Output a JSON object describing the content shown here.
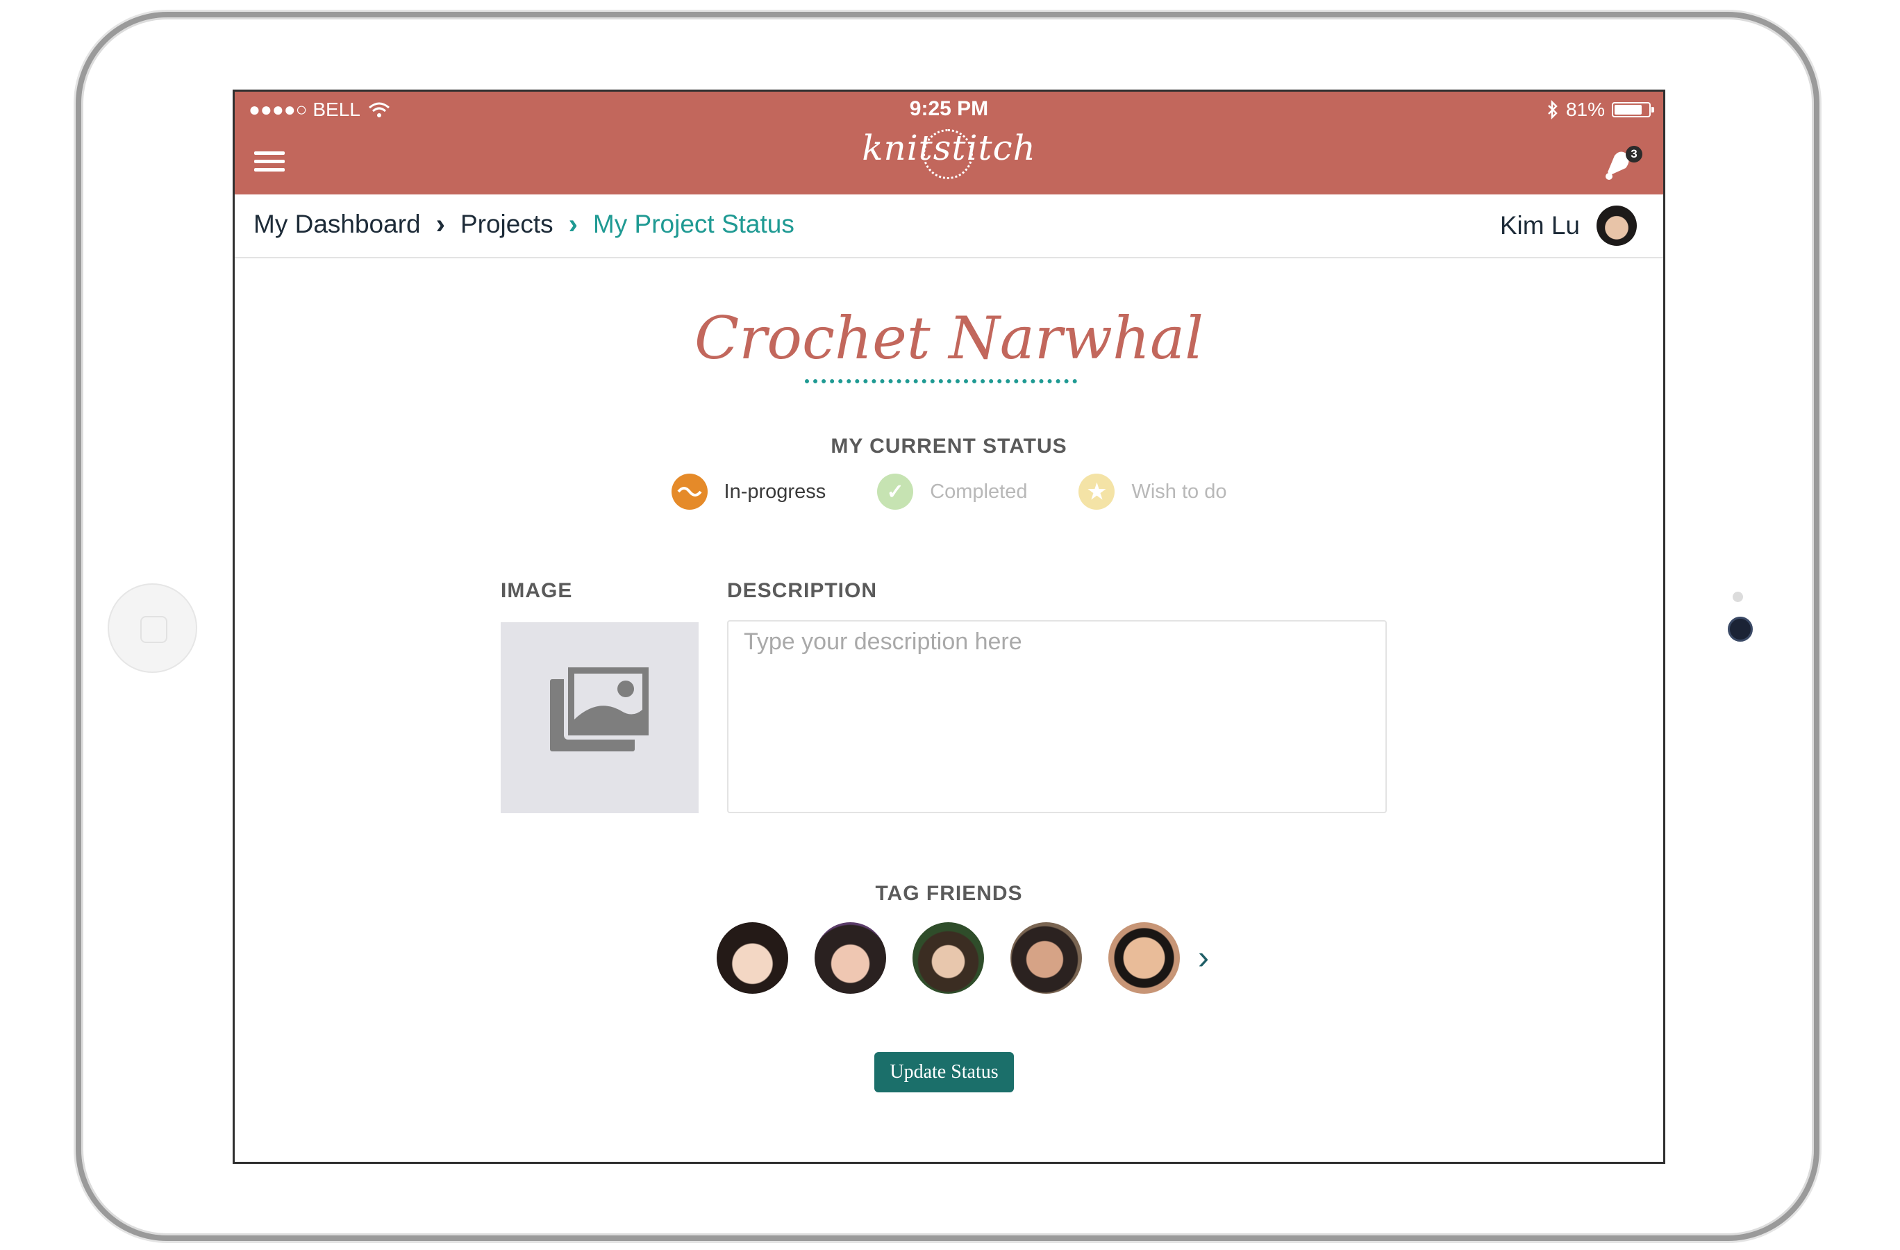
{
  "status_bar": {
    "carrier": "●●●●○ BELL",
    "time": "9:25 PM",
    "battery": "81%",
    "battery_level": 0.81
  },
  "app": {
    "logo": "knitstitch",
    "notifications_count": "3"
  },
  "breadcrumb": [
    "My Dashboard",
    "Projects",
    "My Project Status"
  ],
  "user": {
    "name": "Kim Lu"
  },
  "project": {
    "title": "Crochet Narwhal"
  },
  "status_section": {
    "heading": "MY CURRENT STATUS",
    "options": [
      {
        "label": "In-progress",
        "state": "selected",
        "color": "#e58a29"
      },
      {
        "label": "Completed",
        "state": "unselected",
        "color": "#c6e3b2"
      },
      {
        "label": "Wish to do",
        "state": "unselected",
        "color": "#f4e3a6"
      }
    ]
  },
  "image_section": {
    "heading": "IMAGE"
  },
  "description_section": {
    "heading": "DESCRIPTION",
    "placeholder": "Type your description here",
    "value": ""
  },
  "tag_friends": {
    "heading": "TAG FRIENDS",
    "friends_count": 5
  },
  "actions": {
    "update_label": "Update Status"
  },
  "colors": {
    "header": "#c2675c",
    "accent_teal": "#1f9a93",
    "button": "#1b6f6a"
  }
}
